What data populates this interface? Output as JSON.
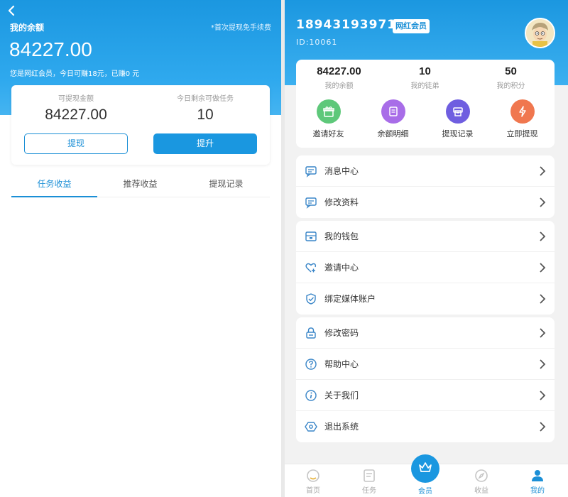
{
  "left": {
    "my_balance_label": "我的余额",
    "first_withdraw_note": "*首次提现免手续费",
    "balance": "84227.00",
    "member_note": "您是网红会员，今日可赚18元，已赚0 元",
    "withdrawable_label": "可提现金额",
    "withdrawable_value": "84227.00",
    "tasks_left_label": "今日剩余可做任务",
    "tasks_left_value": "10",
    "withdraw_button": "提现",
    "upgrade_button": "提升",
    "tabs": [
      "任务收益",
      "推荐收益",
      "提现记录"
    ]
  },
  "right": {
    "phone": "18943193971",
    "member_badge": "网红会员",
    "user_id": "ID:10061",
    "stats": [
      {
        "value": "84227.00",
        "label": "我的余额"
      },
      {
        "value": "10",
        "label": "我的徒弟"
      },
      {
        "value": "50",
        "label": "我的积分"
      }
    ],
    "quick_actions": [
      {
        "label": "邀请好友",
        "icon": "gift-icon",
        "color": "#5ec87a"
      },
      {
        "label": "余额明细",
        "icon": "document-icon",
        "color": "#a86de8"
      },
      {
        "label": "提现记录",
        "icon": "printer-icon",
        "color": "#6f5ee0"
      },
      {
        "label": "立即提现",
        "icon": "lightning-icon",
        "color": "#f0774f"
      }
    ],
    "menu_group1": [
      "消息中心",
      "修改资料"
    ],
    "menu_group2": [
      "我的钱包",
      "邀请中心",
      "绑定媒体账户"
    ],
    "menu_group3": [
      "修改密码",
      "帮助中心",
      "关于我们",
      "退出系统"
    ],
    "nav": [
      "首页",
      "任务",
      "会员",
      "收益",
      "我的"
    ],
    "accent_color": "#1a97e0"
  }
}
